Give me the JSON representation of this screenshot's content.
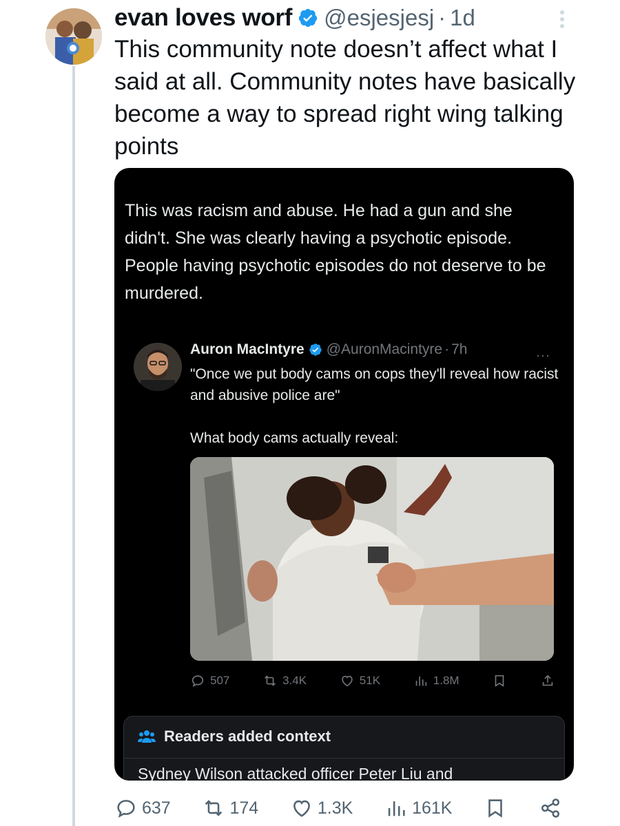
{
  "tweet": {
    "display_name": "evan loves worf",
    "handle": "@esjesjesj",
    "separator": "·",
    "age": "1d",
    "text": "This community note doesn’t affect what I said at all. Community notes have basically become a way to spread right wing talking points",
    "actions": {
      "replies": "637",
      "retweets": "174",
      "likes": "1.3K",
      "views": "161K"
    }
  },
  "embed": {
    "text": "This was racism and abuse. He had a gun and she didn't. She was clearly having a psychotic episode. People having psychotic episodes do not deserve to be murdered.",
    "quoted": {
      "display_name": "Auron MacIntyre",
      "handle": "@AuronMacintyre",
      "separator": "·",
      "age": "7h",
      "more": "···",
      "text": "\"Once we put body cams on cops they'll reveal how racist and abusive police are\"\n\nWhat body cams actually reveal:",
      "actions": {
        "replies": "507",
        "retweets": "3.4K",
        "likes": "51K",
        "views": "1.8M"
      }
    },
    "context": {
      "title": "Readers added context",
      "body": "Sydney Wilson attacked officer Peter Liu and"
    }
  },
  "colors": {
    "verified": "#1d9bf0",
    "text_dark": "#0f1419",
    "text_muted": "#536471",
    "embed_bg": "#000000",
    "context_icon": "#1d9bf0"
  }
}
